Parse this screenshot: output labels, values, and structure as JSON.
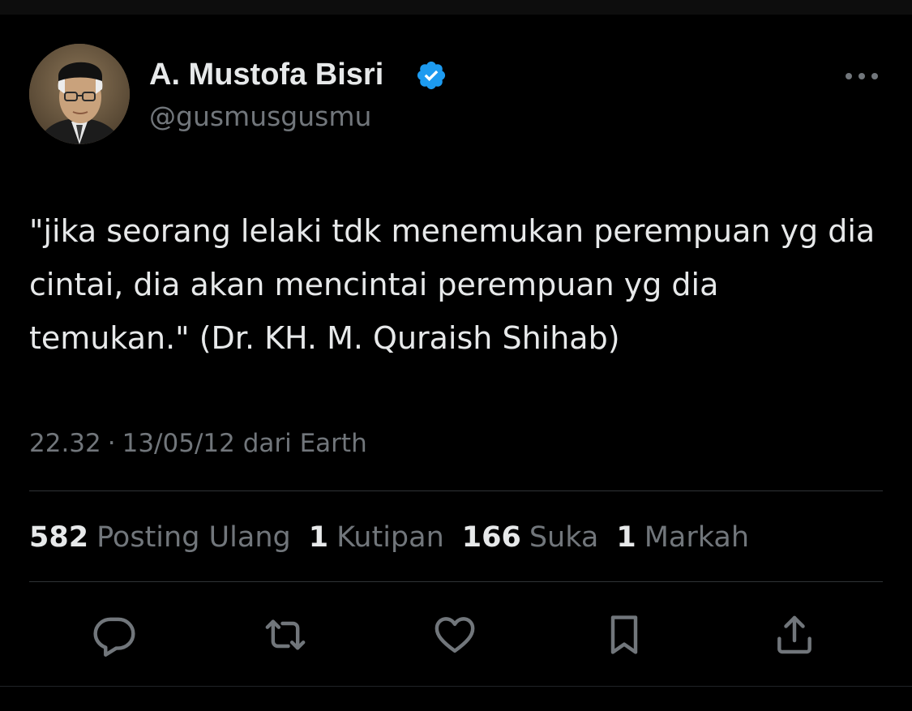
{
  "tweet": {
    "author": {
      "display_name": "A. Mustofa Bisri",
      "handle": "@gusmusgusmu",
      "verified": true,
      "avatar_icon": "profile-photo"
    },
    "text": "\"jika seorang lelaki tdk menemukan perempuan yg dia cintai, dia akan mencintai perempuan yg dia temukan.\" (Dr. KH. M. Quraish Shihab)",
    "time": "22.32",
    "separator": "·",
    "date": "13/05/12",
    "source": "dari Earth"
  },
  "stats": [
    {
      "count": "582",
      "label": "Posting Ulang"
    },
    {
      "count": "1",
      "label": "Kutipan"
    },
    {
      "count": "166",
      "label": "Suka"
    },
    {
      "count": "1",
      "label": "Markah"
    }
  ],
  "actions": [
    {
      "icon": "reply-icon"
    },
    {
      "icon": "repost-icon"
    },
    {
      "icon": "like-icon"
    },
    {
      "icon": "bookmark-icon"
    },
    {
      "icon": "share-icon"
    }
  ],
  "colors": {
    "background": "#000000",
    "text_primary": "#e7e9ea",
    "text_secondary": "#71767b",
    "divider": "#2f3336",
    "verified_badge": "#1d9bf0"
  }
}
